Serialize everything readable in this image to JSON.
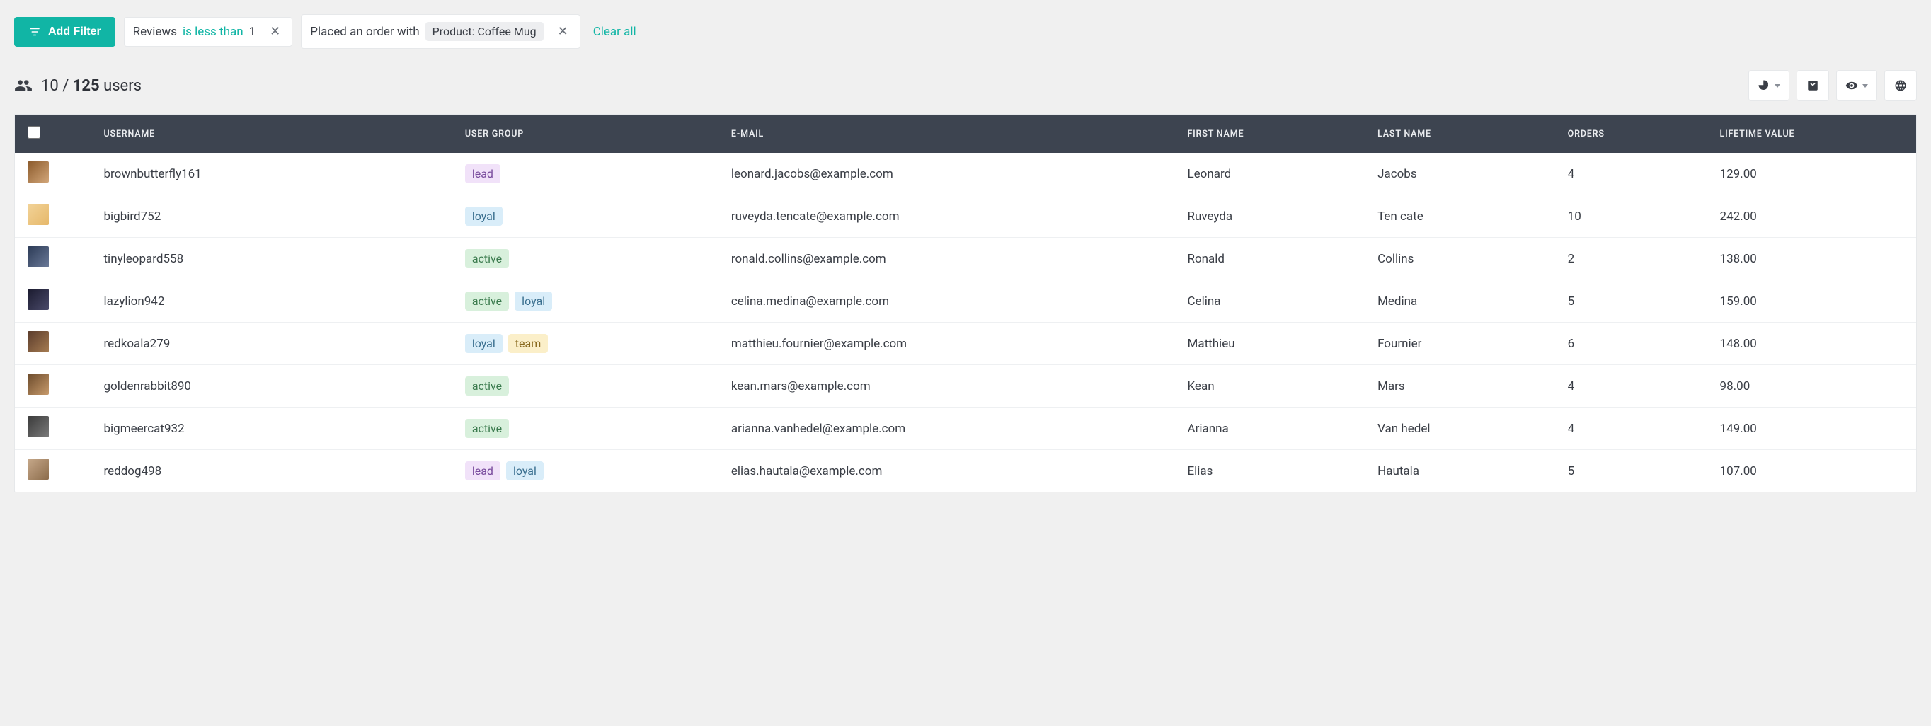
{
  "filters": {
    "add_label": "Add Filter",
    "chips": [
      {
        "field": "Reviews",
        "operator": "is less than",
        "value": "1"
      },
      {
        "field": "Placed an order with",
        "token": "Product: Coffee Mug"
      }
    ],
    "clear_label": "Clear all"
  },
  "summary": {
    "visible": "10",
    "total": "125",
    "separator": " / ",
    "suffix": " users"
  },
  "columns": {
    "username": "Username",
    "group": "User Group",
    "email": "E-mail",
    "firstname": "First Name",
    "lastname": "Last Name",
    "orders": "Orders",
    "ltv": "Lifetime Value"
  },
  "rows": [
    {
      "avatar": "av1",
      "username": "brownbutterfly161",
      "groups": [
        "lead"
      ],
      "email": "leonard.jacobs@example.com",
      "firstname": "Leonard",
      "lastname": "Jacobs",
      "orders": "4",
      "ltv": "129.00"
    },
    {
      "avatar": "av2",
      "username": "bigbird752",
      "groups": [
        "loyal"
      ],
      "email": "ruveyda.tencate@example.com",
      "firstname": "Ruveyda",
      "lastname": "Ten cate",
      "orders": "10",
      "ltv": "242.00"
    },
    {
      "avatar": "av3",
      "username": "tinyleopard558",
      "groups": [
        "active"
      ],
      "email": "ronald.collins@example.com",
      "firstname": "Ronald",
      "lastname": "Collins",
      "orders": "2",
      "ltv": "138.00"
    },
    {
      "avatar": "av4",
      "username": "lazylion942",
      "groups": [
        "active",
        "loyal"
      ],
      "email": "celina.medina@example.com",
      "firstname": "Celina",
      "lastname": "Medina",
      "orders": "5",
      "ltv": "159.00"
    },
    {
      "avatar": "av5",
      "username": "redkoala279",
      "groups": [
        "loyal",
        "team"
      ],
      "email": "matthieu.fournier@example.com",
      "firstname": "Matthieu",
      "lastname": "Fournier",
      "orders": "6",
      "ltv": "148.00"
    },
    {
      "avatar": "av6",
      "username": "goldenrabbit890",
      "groups": [
        "active"
      ],
      "email": "kean.mars@example.com",
      "firstname": "Kean",
      "lastname": "Mars",
      "orders": "4",
      "ltv": "98.00"
    },
    {
      "avatar": "av7",
      "username": "bigmeercat932",
      "groups": [
        "active"
      ],
      "email": "arianna.vanhedel@example.com",
      "firstname": "Arianna",
      "lastname": "Van hedel",
      "orders": "4",
      "ltv": "149.00"
    },
    {
      "avatar": "av8",
      "username": "reddog498",
      "groups": [
        "lead",
        "loyal"
      ],
      "email": "elias.hautala@example.com",
      "firstname": "Elias",
      "lastname": "Hautala",
      "orders": "5",
      "ltv": "107.00"
    }
  ]
}
